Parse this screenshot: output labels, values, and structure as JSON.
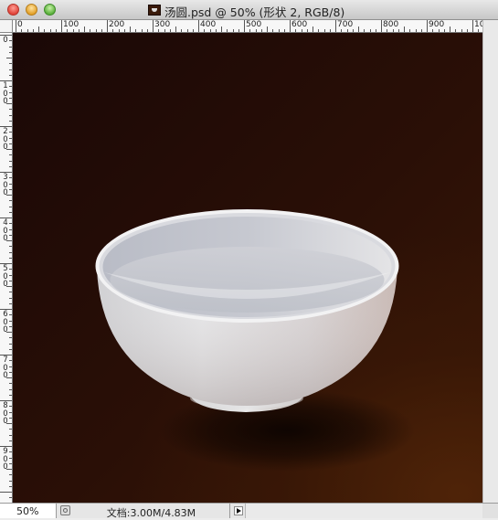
{
  "window": {
    "title": "汤圆.psd @ 50% (形状 2, RGB/8)",
    "buttons": [
      "close",
      "minimize",
      "zoom"
    ]
  },
  "ruler": {
    "horizontal_labels": [
      "0",
      "100",
      "200",
      "300",
      "400",
      "500",
      "600",
      "700",
      "800",
      "900",
      "1000"
    ],
    "vertical_labels": [
      "0",
      "100",
      "200",
      "300",
      "400",
      "500",
      "600",
      "700",
      "800",
      "900"
    ]
  },
  "canvas": {
    "background_dark": "#1a0806",
    "background_warm": "#4a2208",
    "object": "bowl",
    "bowl_color": "#dcdcdf"
  },
  "status": {
    "zoom": "50%",
    "doc_info": "文档:3.00M/4.83M"
  },
  "icons": [
    "document-thumbnail-icon",
    "preview-status-icon",
    "status-menu-arrow-icon"
  ]
}
